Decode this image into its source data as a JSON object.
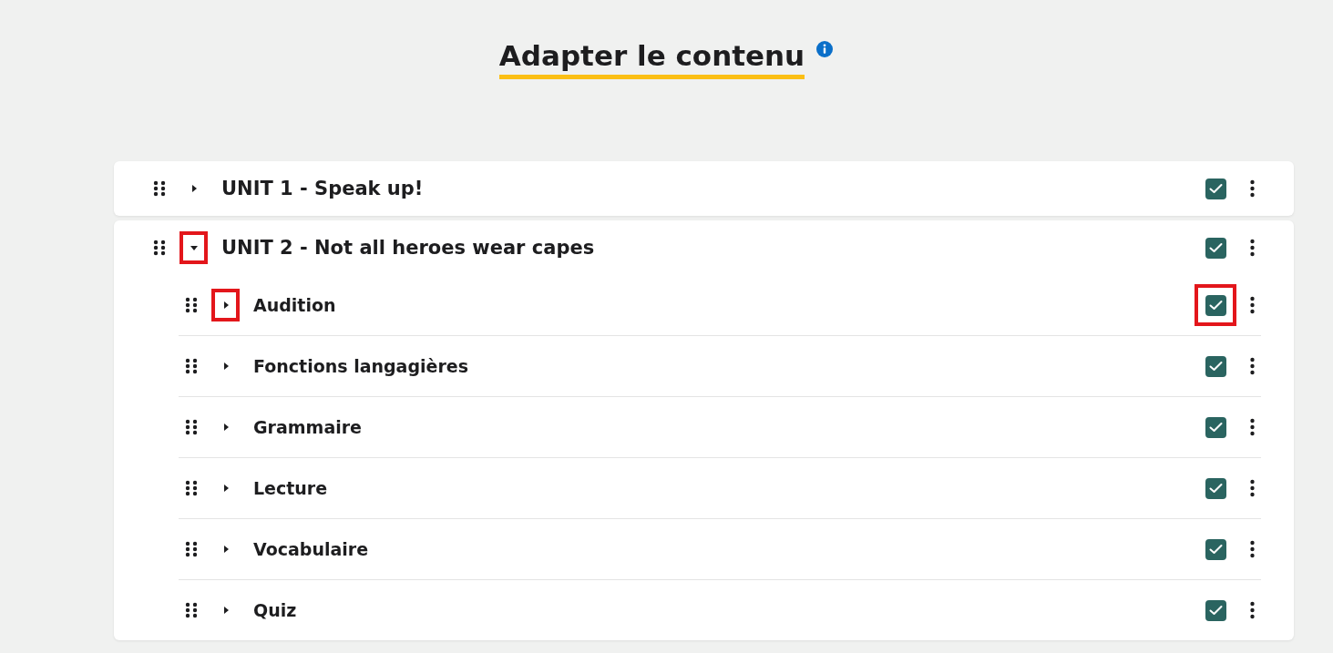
{
  "title": "Adapter le contenu",
  "units": [
    {
      "label": "UNIT 1 - Speak up!",
      "expanded": false,
      "checked": true,
      "toggle_highlighted": false,
      "checkbox_highlighted": false
    },
    {
      "label": "UNIT 2 - Not all heroes wear capes",
      "expanded": true,
      "checked": true,
      "toggle_highlighted": true,
      "checkbox_highlighted": false,
      "children": [
        {
          "label": "Audition",
          "expanded": false,
          "checked": true,
          "toggle_highlighted": true,
          "checkbox_highlighted": true
        },
        {
          "label": "Fonctions langagières",
          "expanded": false,
          "checked": true,
          "toggle_highlighted": false,
          "checkbox_highlighted": false
        },
        {
          "label": "Grammaire",
          "expanded": false,
          "checked": true,
          "toggle_highlighted": false,
          "checkbox_highlighted": false
        },
        {
          "label": "Lecture",
          "expanded": false,
          "checked": true,
          "toggle_highlighted": false,
          "checkbox_highlighted": false
        },
        {
          "label": "Vocabulaire",
          "expanded": false,
          "checked": true,
          "toggle_highlighted": false,
          "checkbox_highlighted": false
        },
        {
          "label": "Quiz",
          "expanded": false,
          "checked": true,
          "toggle_highlighted": false,
          "checkbox_highlighted": false
        }
      ]
    }
  ]
}
